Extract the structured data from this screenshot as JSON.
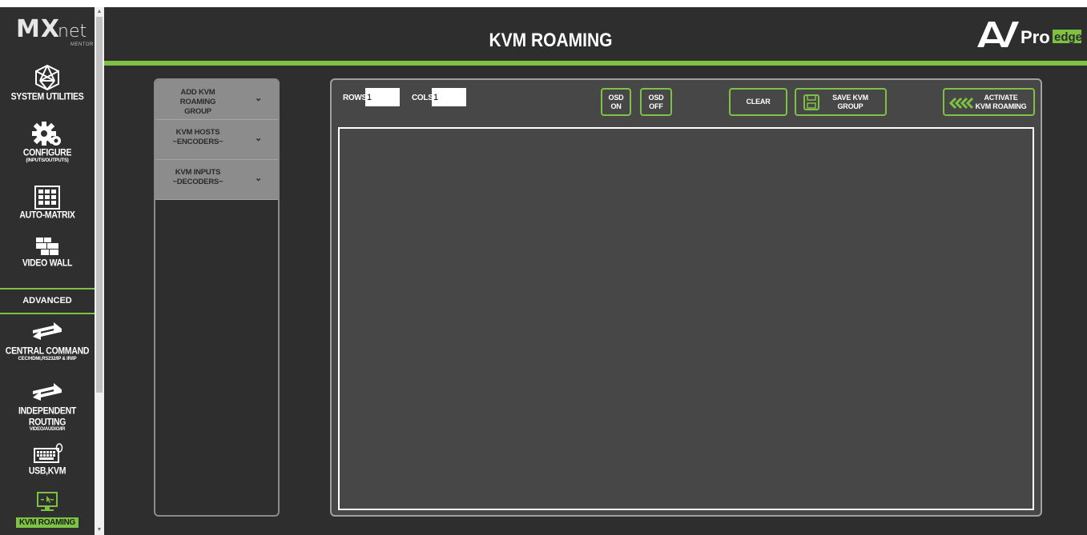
{
  "app": {
    "logo_main": "MX",
    "logo_sub": "net",
    "logo_tag": "MENTOR",
    "brand_av": "AV",
    "brand_pro": "Pro",
    "brand_edge": "edge"
  },
  "sidebar": {
    "items": [
      {
        "label": "SYSTEM UTILITIES",
        "sub": "",
        "icon": "network-sphere-icon"
      },
      {
        "label": "CONFIGURE",
        "sub": "(INPUTS/OUTPUTS)",
        "icon": "gear-icon"
      },
      {
        "label": "AUTO-MATRIX",
        "sub": "",
        "icon": "matrix-grid-icon"
      },
      {
        "label": "VIDEO WALL",
        "sub": "",
        "icon": "video-wall-icon"
      },
      {
        "label": "CENTRAL COMMAND",
        "sub": "CEC/HDMI,RS232/IP & IR/IP",
        "icon": "bidirectional-arrow-icon"
      },
      {
        "label": "INDEPENDENT ROUTING",
        "sub": "VIDEO/AUDIO/IR",
        "icon": "bidirectional-arrow-icon"
      },
      {
        "label": "USB,KVM",
        "sub": "",
        "icon": "keyboard-mouse-icon"
      },
      {
        "label": "KVM ROAMING",
        "sub": "",
        "icon": "monitor-cursor-icon"
      }
    ],
    "advanced_label": "ADVANCED",
    "active": "KVM ROAMING"
  },
  "header": {
    "title": "KVM ROAMING"
  },
  "accordion": {
    "items": [
      {
        "line1": "ADD KVM",
        "line2": "ROAMING GROUP"
      },
      {
        "line1": "KVM HOSTS",
        "line2": "~ENCODERS~"
      },
      {
        "line1": "KVM INPUTS",
        "line2": "~DECODERS~"
      }
    ],
    "chevron": "⌄"
  },
  "toolbar": {
    "rows_label": "ROWS:",
    "rows_value": "1",
    "cols_label": "COLS:",
    "cols_value": "1",
    "osd_on_line1": "OSD",
    "osd_on_line2": "ON",
    "osd_off_line1": "OSD",
    "osd_off_line2": "OFF",
    "clear_label": "CLEAR",
    "save_line1": "SAVE KVM",
    "save_line2": "GROUP",
    "activate_line1": "ACTIVATE",
    "activate_line2": "KVM ROAMING"
  },
  "colors": {
    "accent": "#7dc242",
    "background": "#2e2e2e",
    "panel": "#474747",
    "accordion": "#8c8c8c"
  }
}
